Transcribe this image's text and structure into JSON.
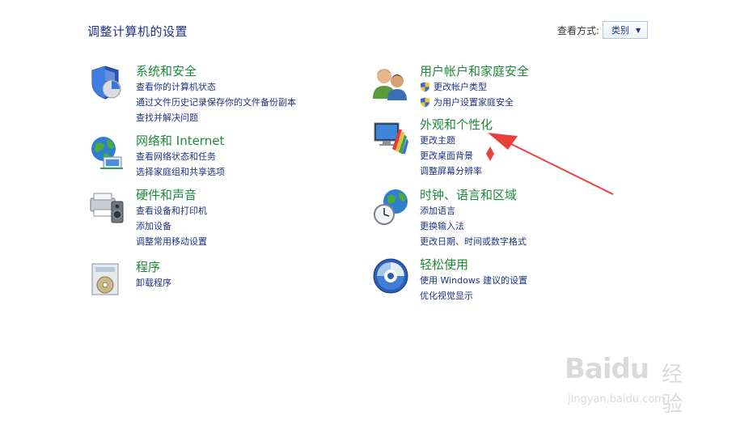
{
  "page": {
    "title": "调整计算机的设置"
  },
  "view_by": {
    "label": "查看方式:",
    "selected": "类别"
  },
  "categories": [
    {
      "title": "系统和安全",
      "icon": "system-security-icon",
      "links": [
        "查看你的计算机状态",
        "通过文件历史记录保存你的文件备份副本",
        "查找并解决问题"
      ]
    },
    {
      "title": "网络和 Internet",
      "icon": "network-internet-icon",
      "links": [
        "查看网络状态和任务",
        "选择家庭组和共享选项"
      ]
    },
    {
      "title": "硬件和声音",
      "icon": "hardware-sound-icon",
      "links": [
        "查看设备和打印机",
        "添加设备",
        "调整常用移动设置"
      ]
    },
    {
      "title": "程序",
      "icon": "programs-icon",
      "links": [
        "卸载程序"
      ]
    },
    {
      "title": "用户帐户和家庭安全",
      "icon": "user-accounts-icon",
      "links": [
        "更改帐户类型",
        "为用户设置家庭安全"
      ]
    },
    {
      "title": "外观和个性化",
      "icon": "appearance-icon",
      "links": [
        "更改主题",
        "更改桌面背景",
        "调整屏幕分辨率"
      ]
    },
    {
      "title": "时钟、语言和区域",
      "icon": "clock-language-region-icon",
      "links": [
        "添加语言",
        "更换输入法",
        "更改日期、时间或数字格式"
      ]
    },
    {
      "title": "轻松使用",
      "icon": "ease-of-access-icon",
      "links": [
        "使用 Windows 建议的设置",
        "优化视觉显示"
      ]
    }
  ],
  "watermark": {
    "logo": "Baidu",
    "logo_cn": "经验",
    "url": "jingyan.baidu.com"
  },
  "colors": {
    "category_title": "#1d8a3a",
    "link": "#1e3287",
    "annotation": "#e8403a"
  }
}
